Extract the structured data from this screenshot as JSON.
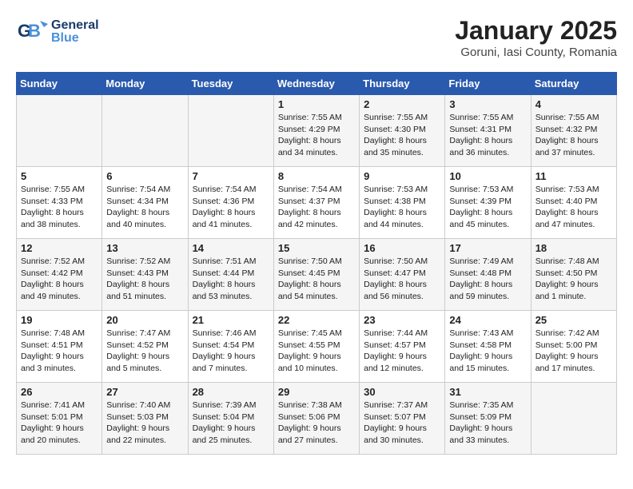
{
  "header": {
    "logo_general": "General",
    "logo_blue": "Blue",
    "month_title": "January 2025",
    "location": "Goruni, Iasi County, Romania"
  },
  "days_of_week": [
    "Sunday",
    "Monday",
    "Tuesday",
    "Wednesday",
    "Thursday",
    "Friday",
    "Saturday"
  ],
  "weeks": [
    [
      {
        "day": "",
        "content": ""
      },
      {
        "day": "",
        "content": ""
      },
      {
        "day": "",
        "content": ""
      },
      {
        "day": "1",
        "content": "Sunrise: 7:55 AM\nSunset: 4:29 PM\nDaylight: 8 hours\nand 34 minutes."
      },
      {
        "day": "2",
        "content": "Sunrise: 7:55 AM\nSunset: 4:30 PM\nDaylight: 8 hours\nand 35 minutes."
      },
      {
        "day": "3",
        "content": "Sunrise: 7:55 AM\nSunset: 4:31 PM\nDaylight: 8 hours\nand 36 minutes."
      },
      {
        "day": "4",
        "content": "Sunrise: 7:55 AM\nSunset: 4:32 PM\nDaylight: 8 hours\nand 37 minutes."
      }
    ],
    [
      {
        "day": "5",
        "content": "Sunrise: 7:55 AM\nSunset: 4:33 PM\nDaylight: 8 hours\nand 38 minutes."
      },
      {
        "day": "6",
        "content": "Sunrise: 7:54 AM\nSunset: 4:34 PM\nDaylight: 8 hours\nand 40 minutes."
      },
      {
        "day": "7",
        "content": "Sunrise: 7:54 AM\nSunset: 4:36 PM\nDaylight: 8 hours\nand 41 minutes."
      },
      {
        "day": "8",
        "content": "Sunrise: 7:54 AM\nSunset: 4:37 PM\nDaylight: 8 hours\nand 42 minutes."
      },
      {
        "day": "9",
        "content": "Sunrise: 7:53 AM\nSunset: 4:38 PM\nDaylight: 8 hours\nand 44 minutes."
      },
      {
        "day": "10",
        "content": "Sunrise: 7:53 AM\nSunset: 4:39 PM\nDaylight: 8 hours\nand 45 minutes."
      },
      {
        "day": "11",
        "content": "Sunrise: 7:53 AM\nSunset: 4:40 PM\nDaylight: 8 hours\nand 47 minutes."
      }
    ],
    [
      {
        "day": "12",
        "content": "Sunrise: 7:52 AM\nSunset: 4:42 PM\nDaylight: 8 hours\nand 49 minutes."
      },
      {
        "day": "13",
        "content": "Sunrise: 7:52 AM\nSunset: 4:43 PM\nDaylight: 8 hours\nand 51 minutes."
      },
      {
        "day": "14",
        "content": "Sunrise: 7:51 AM\nSunset: 4:44 PM\nDaylight: 8 hours\nand 53 minutes."
      },
      {
        "day": "15",
        "content": "Sunrise: 7:50 AM\nSunset: 4:45 PM\nDaylight: 8 hours\nand 54 minutes."
      },
      {
        "day": "16",
        "content": "Sunrise: 7:50 AM\nSunset: 4:47 PM\nDaylight: 8 hours\nand 56 minutes."
      },
      {
        "day": "17",
        "content": "Sunrise: 7:49 AM\nSunset: 4:48 PM\nDaylight: 8 hours\nand 59 minutes."
      },
      {
        "day": "18",
        "content": "Sunrise: 7:48 AM\nSunset: 4:50 PM\nDaylight: 9 hours\nand 1 minute."
      }
    ],
    [
      {
        "day": "19",
        "content": "Sunrise: 7:48 AM\nSunset: 4:51 PM\nDaylight: 9 hours\nand 3 minutes."
      },
      {
        "day": "20",
        "content": "Sunrise: 7:47 AM\nSunset: 4:52 PM\nDaylight: 9 hours\nand 5 minutes."
      },
      {
        "day": "21",
        "content": "Sunrise: 7:46 AM\nSunset: 4:54 PM\nDaylight: 9 hours\nand 7 minutes."
      },
      {
        "day": "22",
        "content": "Sunrise: 7:45 AM\nSunset: 4:55 PM\nDaylight: 9 hours\nand 10 minutes."
      },
      {
        "day": "23",
        "content": "Sunrise: 7:44 AM\nSunset: 4:57 PM\nDaylight: 9 hours\nand 12 minutes."
      },
      {
        "day": "24",
        "content": "Sunrise: 7:43 AM\nSunset: 4:58 PM\nDaylight: 9 hours\nand 15 minutes."
      },
      {
        "day": "25",
        "content": "Sunrise: 7:42 AM\nSunset: 5:00 PM\nDaylight: 9 hours\nand 17 minutes."
      }
    ],
    [
      {
        "day": "26",
        "content": "Sunrise: 7:41 AM\nSunset: 5:01 PM\nDaylight: 9 hours\nand 20 minutes."
      },
      {
        "day": "27",
        "content": "Sunrise: 7:40 AM\nSunset: 5:03 PM\nDaylight: 9 hours\nand 22 minutes."
      },
      {
        "day": "28",
        "content": "Sunrise: 7:39 AM\nSunset: 5:04 PM\nDaylight: 9 hours\nand 25 minutes."
      },
      {
        "day": "29",
        "content": "Sunrise: 7:38 AM\nSunset: 5:06 PM\nDaylight: 9 hours\nand 27 minutes."
      },
      {
        "day": "30",
        "content": "Sunrise: 7:37 AM\nSunset: 5:07 PM\nDaylight: 9 hours\nand 30 minutes."
      },
      {
        "day": "31",
        "content": "Sunrise: 7:35 AM\nSunset: 5:09 PM\nDaylight: 9 hours\nand 33 minutes."
      },
      {
        "day": "",
        "content": ""
      }
    ]
  ]
}
